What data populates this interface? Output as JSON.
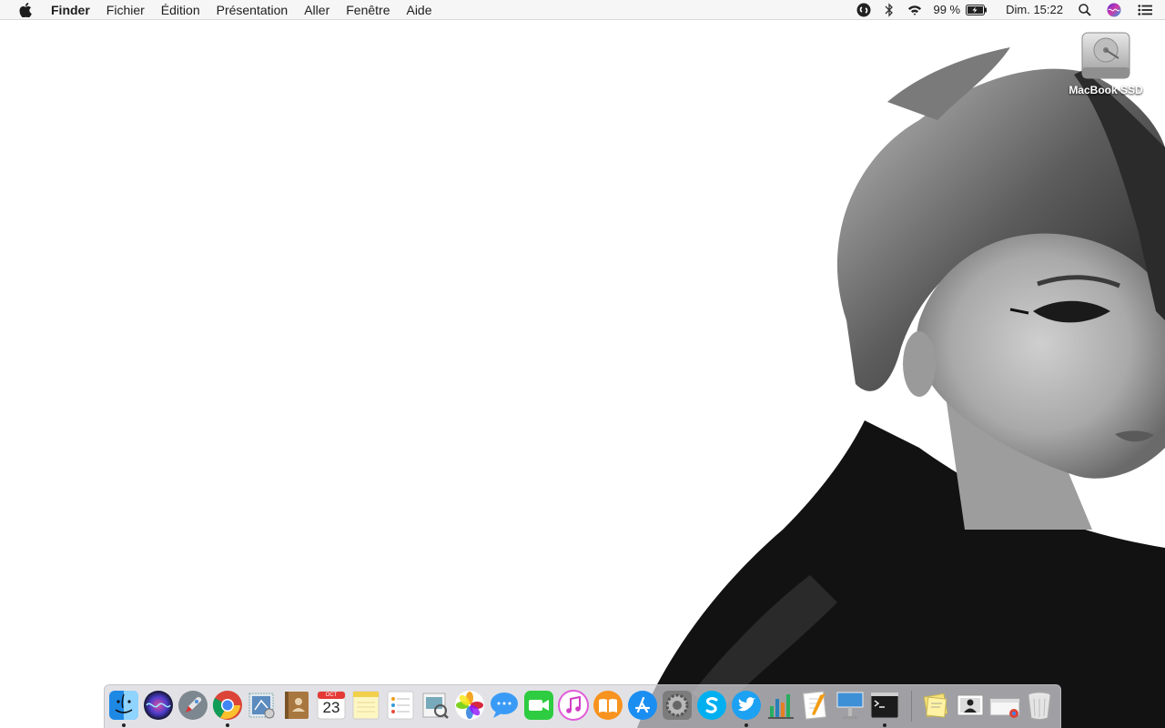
{
  "menubar": {
    "items": [
      "Finder",
      "Fichier",
      "Édition",
      "Présentation",
      "Aller",
      "Fenêtre",
      "Aide"
    ],
    "battery_text": "99 %",
    "clock": "Dim. 15:22"
  },
  "desktop": {
    "disk_label": "MacBook SSD"
  },
  "dock": {
    "calendar": {
      "month": "OCT",
      "day": "23"
    },
    "apps": [
      {
        "name": "finder",
        "running": true
      },
      {
        "name": "siri",
        "running": false
      },
      {
        "name": "launchpad",
        "running": false
      },
      {
        "name": "chrome",
        "running": true
      },
      {
        "name": "mail",
        "running": false
      },
      {
        "name": "contacts",
        "running": false
      },
      {
        "name": "calendar",
        "running": false
      },
      {
        "name": "notes",
        "running": false
      },
      {
        "name": "reminders",
        "running": false
      },
      {
        "name": "preview",
        "running": false
      },
      {
        "name": "photos",
        "running": false
      },
      {
        "name": "messages",
        "running": false
      },
      {
        "name": "facetime",
        "running": false
      },
      {
        "name": "itunes",
        "running": false
      },
      {
        "name": "ibooks",
        "running": false
      },
      {
        "name": "app-store",
        "running": false
      },
      {
        "name": "system-preferences",
        "running": false
      },
      {
        "name": "skype",
        "running": false
      },
      {
        "name": "twitter",
        "running": true
      },
      {
        "name": "numbers",
        "running": false
      },
      {
        "name": "pages",
        "running": false
      },
      {
        "name": "keynote",
        "running": false
      },
      {
        "name": "terminal",
        "running": true
      },
      {
        "name": "stickies-folder",
        "running": false
      },
      {
        "name": "photo-stack",
        "running": false
      },
      {
        "name": "downloads-stack",
        "running": false
      },
      {
        "name": "trash",
        "running": false
      }
    ]
  },
  "colors": {
    "menubar_bg": "#f6f6f6",
    "dock_bg": "#d7d7dc",
    "finder_blue": "#1e88e5",
    "twitter_blue": "#1da1f2",
    "skype_blue": "#00aff0"
  }
}
